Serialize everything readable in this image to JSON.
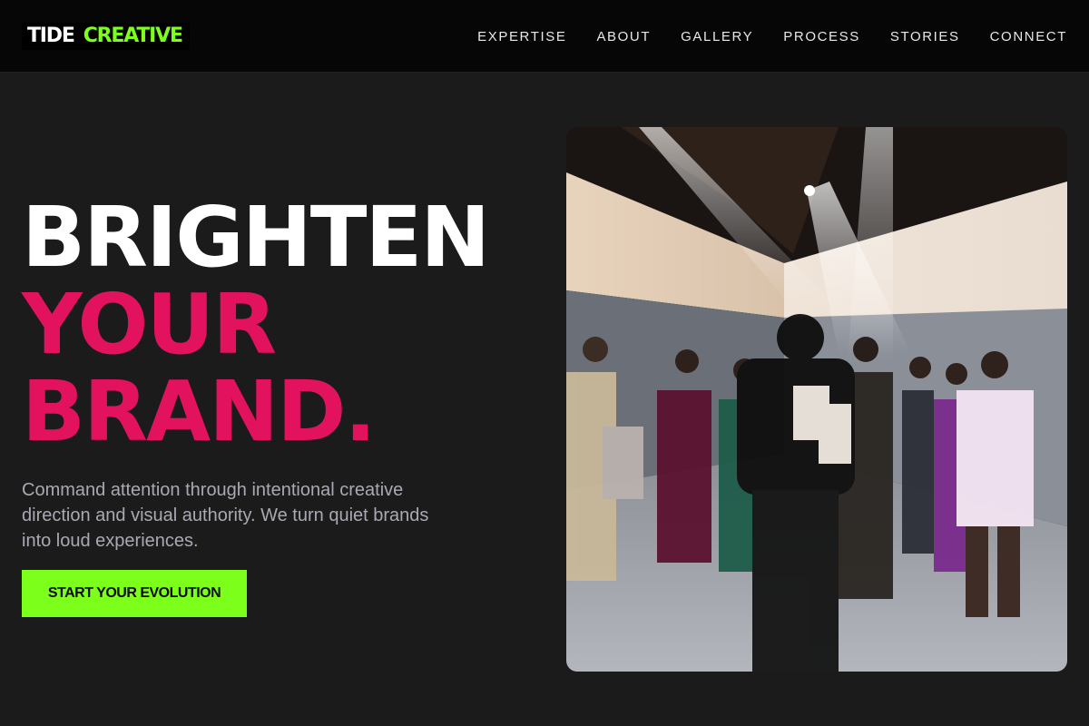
{
  "brand": {
    "part1": "TIDE",
    "part2": "CREATIVE",
    "accent": "#7cff1a"
  },
  "nav": {
    "items": [
      {
        "label": "EXPERTISE"
      },
      {
        "label": "ABOUT"
      },
      {
        "label": "GALLERY"
      },
      {
        "label": "PROCESS"
      },
      {
        "label": "STORIES"
      },
      {
        "label": "CONNECT"
      }
    ]
  },
  "hero": {
    "line1": "BRIGHTEN",
    "line2": "YOUR",
    "line3": "BRAND.",
    "highlight_color": "#e2125f",
    "subtext": "Command attention through intentional creative direction and visual authority. We turn quiet brands into loud experiences.",
    "cta_label": "START YOUR EVOLUTION",
    "cta_color": "#7cff1a",
    "image_label": "",
    "image_alt": "Fashion event with models in a spotlit room"
  },
  "colors": {
    "background": "#1b1b1b",
    "header": "#060606"
  }
}
